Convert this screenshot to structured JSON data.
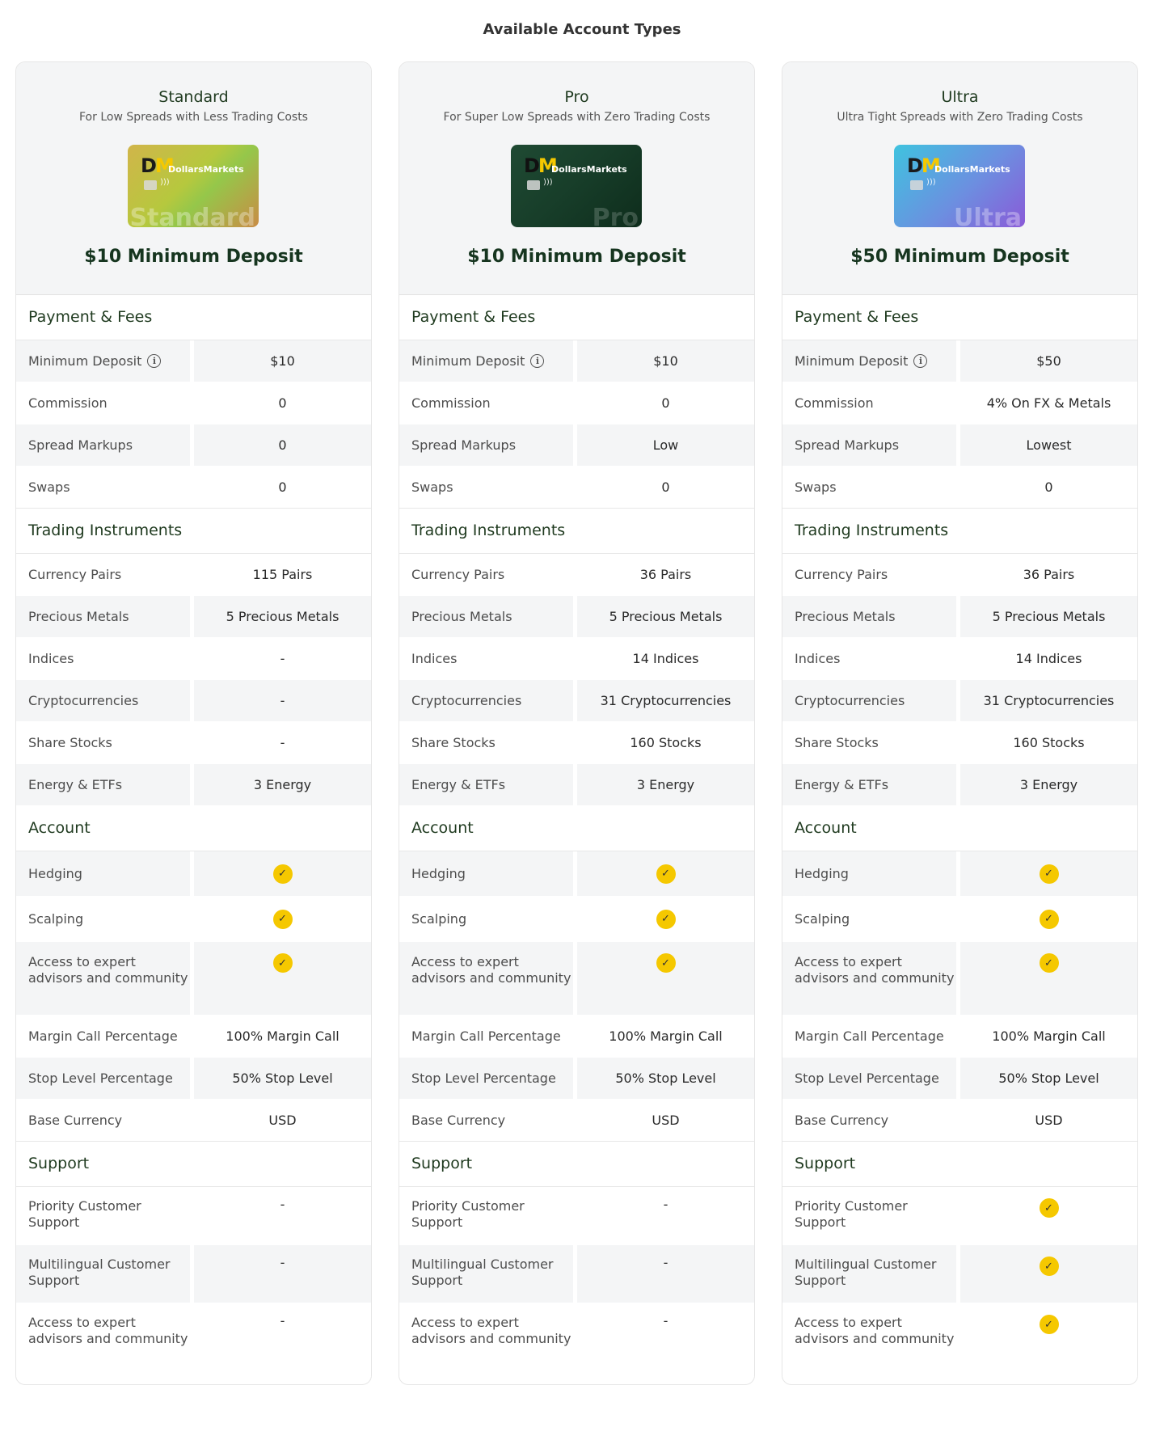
{
  "page_title": "Available Account Types",
  "labels": {
    "payment_fees": "Payment & Fees",
    "minimum_deposit": "Minimum Deposit",
    "commission": "Commission",
    "spread_markups": "Spread Markups",
    "swaps": "Swaps",
    "trading_instruments": "Trading Instruments",
    "currency_pairs": "Currency Pairs",
    "precious_metals": "Precious Metals",
    "indices": "Indices",
    "cryptocurrencies": "Cryptocurrencies",
    "share_stocks": "Share Stocks",
    "energy_etfs": "Energy & ETFs",
    "account": "Account",
    "hedging": "Hedging",
    "scalping": "Scalping",
    "expert_advisors": "Access to expert advisors and community",
    "margin_call": "Margin Call Percentage",
    "stop_level": "Stop Level Percentage",
    "base_currency": "Base Currency",
    "support": "Support",
    "priority_support": "Priority Customer Support",
    "multilingual_support": "Multilingual Customer Support",
    "support_expert_advisors": "Access to expert advisors and community"
  },
  "brand": {
    "logo_letters": "DM",
    "name": "DollarsMarkets",
    "accent_color": "#f5c800"
  },
  "accounts": [
    {
      "name": "Standard",
      "tagline": "For Low Spreads with Less Trading Costs",
      "card_watermark": "Standard",
      "min_deposit_heading": "$10 Minimum Deposit",
      "minimum_deposit": "$10",
      "commission": "0",
      "spread_markups": "0",
      "swaps": "0",
      "currency_pairs": "115 Pairs",
      "precious_metals": "5 Precious Metals",
      "indices": "-",
      "cryptocurrencies": "-",
      "share_stocks": "-",
      "energy_etfs": "3 Energy",
      "margin_call": "100% Margin Call",
      "stop_level": "50% Stop Level",
      "base_currency": "USD",
      "priority_support": "-",
      "multilingual_support": "-",
      "support_expert_advisors": "-"
    },
    {
      "name": "Pro",
      "tagline": "For Super Low Spreads with Zero Trading Costs",
      "card_watermark": "Pro",
      "min_deposit_heading": "$10 Minimum Deposit",
      "minimum_deposit": "$10",
      "commission": "0",
      "spread_markups": "Low",
      "swaps": "0",
      "currency_pairs": "36 Pairs",
      "precious_metals": "5 Precious Metals",
      "indices": "14 Indices",
      "cryptocurrencies": "31 Cryptocurrencies",
      "share_stocks": "160 Stocks",
      "energy_etfs": "3 Energy",
      "margin_call": "100% Margin Call",
      "stop_level": "50% Stop Level",
      "base_currency": "USD",
      "priority_support": "-",
      "multilingual_support": "-",
      "support_expert_advisors": "-"
    },
    {
      "name": "Ultra",
      "tagline": "Ultra Tight Spreads with Zero Trading Costs",
      "card_watermark": "Ultra",
      "min_deposit_heading": "$50 Minimum Deposit",
      "minimum_deposit": "$50",
      "commission": "4% On FX & Metals",
      "spread_markups": "Lowest",
      "swaps": "0",
      "currency_pairs": "36 Pairs",
      "precious_metals": "5 Precious Metals",
      "indices": "14 Indices",
      "cryptocurrencies": "31 Cryptocurrencies",
      "share_stocks": "160 Stocks",
      "energy_etfs": "3 Energy",
      "margin_call": "100% Margin Call",
      "stop_level": "50% Stop Level",
      "base_currency": "USD",
      "priority_support": "check",
      "multilingual_support": "check",
      "support_expert_advisors": "check"
    }
  ]
}
